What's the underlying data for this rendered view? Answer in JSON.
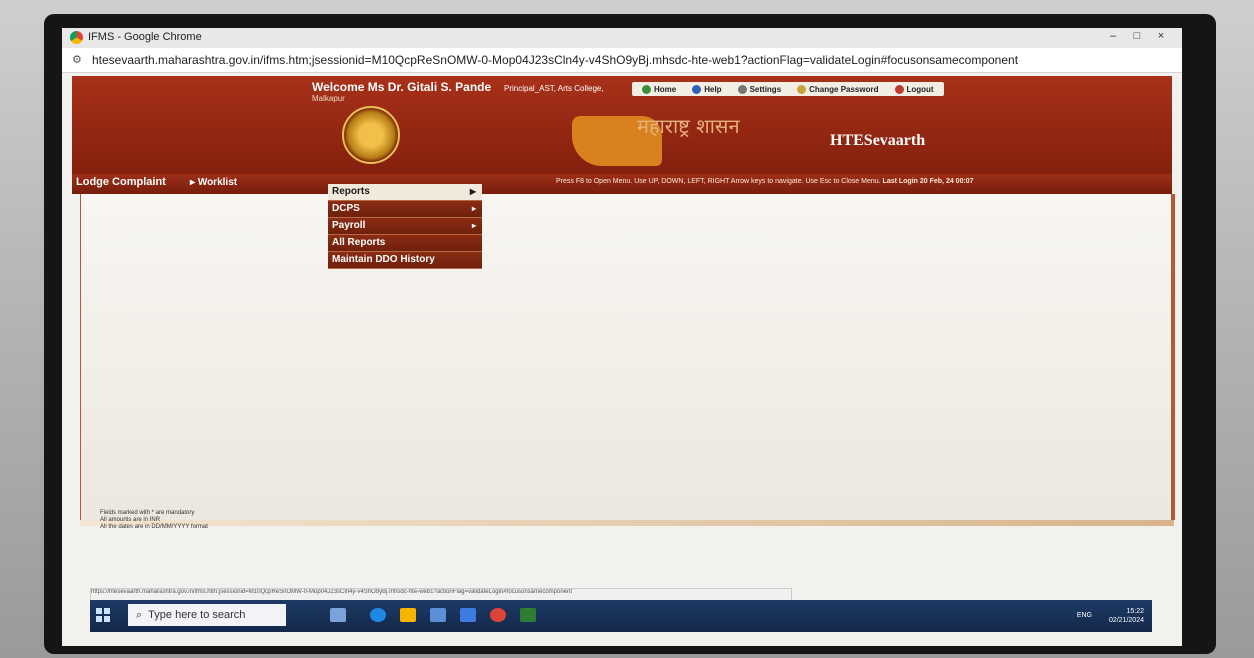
{
  "browser": {
    "title": "IFMS - Google Chrome",
    "url": "htesevaarth.maharashtra.gov.in/ifms.htm;jsessionid=M10QcpReSnOMW-0-Mop04J23sCln4y-v4ShO9yBj.mhsdc-hte-web1?actionFlag=validateLogin#focusonsamecomponent",
    "window_controls": [
      "–",
      "□",
      "×"
    ]
  },
  "header": {
    "welcome": "Welcome Ms Dr. Gitali S. Pande",
    "location": "Malkapur",
    "role": "Principal_AST, Arts College,",
    "nav": [
      {
        "label": "Home",
        "icon": "home-icon"
      },
      {
        "label": "Help",
        "icon": "help-icon"
      },
      {
        "label": "Settings",
        "icon": "settings-icon"
      },
      {
        "label": "Change Password",
        "icon": "key-icon"
      },
      {
        "label": "Logout",
        "icon": "power-icon"
      }
    ],
    "marathi_text": "महाराष्ट्र शासन",
    "brand": "HTESevaarth"
  },
  "menubar": {
    "items": [
      "Lodge Complaint",
      "Worklist"
    ],
    "hint": "Press F8 to Open Menu. Use UP, DOWN, LEFT, RIGHT Arrow keys to navigate. Use Esc to Close Menu.",
    "last_login": "Last Login 20 Feb, 24 00:07"
  },
  "dropdown": {
    "items": [
      {
        "label": "Reports",
        "has_submenu": true
      },
      {
        "label": "DCPS",
        "has_submenu": true
      },
      {
        "label": "Payroll",
        "has_submenu": true
      },
      {
        "label": "All Reports",
        "has_submenu": false
      },
      {
        "label": "Maintain DDO History",
        "has_submenu": false
      }
    ]
  },
  "notes": [
    "Fields marked with * are mandatory",
    "All amounts are in INR",
    "All the dates are in DD/MM/YYYY format"
  ],
  "status_url": "https://htesevaarth.maharashtra.gov.in/ifms.htm;jsessionid=M10QcpReSnOMW-0-Mop04J23sCln4y-v4ShO9yBj.mhsdc-hte-web1?actionFlag=validateLogin#focusonsamecomponent",
  "taskbar": {
    "search_placeholder": "Type here to search",
    "tray": "ENG",
    "time": "15:22",
    "date": "02/21/2024"
  }
}
